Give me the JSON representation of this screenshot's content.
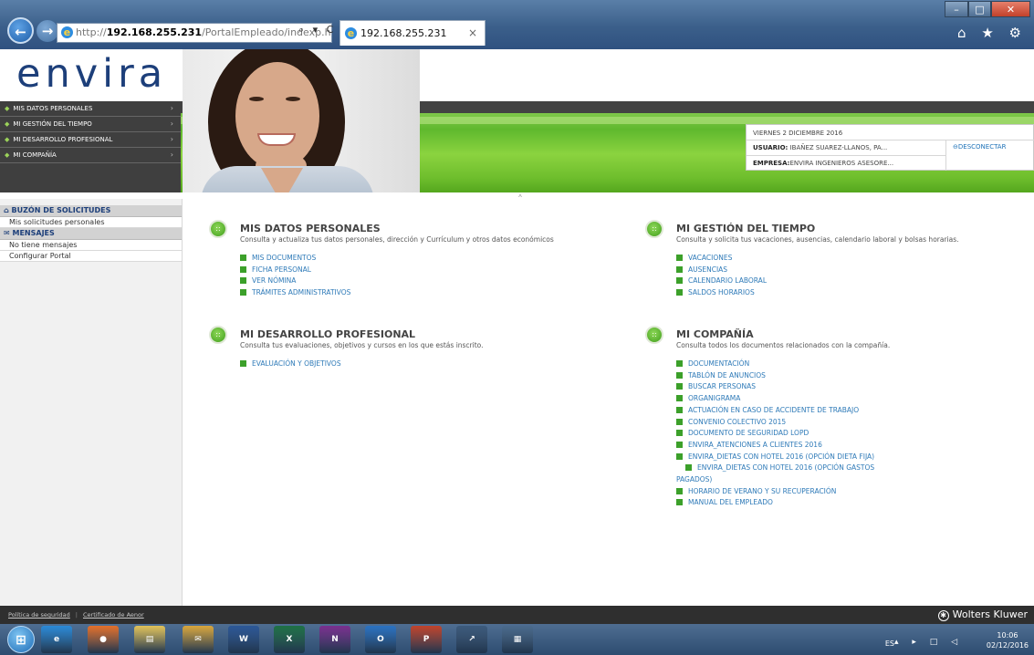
{
  "browser": {
    "url_prefix": "http://",
    "url_host": "192.168.255.231",
    "url_path": "/PortalEmpleado/indexp.html",
    "tab_title": "192.168.255.231",
    "addr_tools": "⌕ ▾ C",
    "tab_close": "×",
    "back_glyph": "←",
    "forward_glyph": "→",
    "favorites_glyphs": "⌂ ★ ⚙",
    "min_glyph": "–",
    "max_glyph": "□",
    "close_glyph": "✕"
  },
  "header": {
    "logo": "envira",
    "menu": [
      {
        "label": "MIS DATOS PERSONALES"
      },
      {
        "label": "MI GESTIÓN DEL TIEMPO"
      },
      {
        "label": "MI DESARROLLO PROFESIONAL"
      },
      {
        "label": "MI COMPAÑÍA"
      }
    ],
    "date": "VIERNES 2 DICIEMBRE 2016",
    "user_key": "USUARIO:",
    "user_value": "IBAÑEZ SUAREZ-LLANOS, PA...",
    "company_key": "EMPRESA:",
    "company_value": "ENVIRA INGENIEROS ASESORE...",
    "logout": "DESCONECTAR",
    "collapse_glyph": "˄"
  },
  "left_panel": {
    "inbox_title": "BUZÓN DE SOLICITUDES",
    "inbox_item": "Mis solicitudes personales",
    "messages_title": "MENSAJES",
    "messages_item": "No tiene mensajes",
    "configure": "Configurar Portal"
  },
  "sections": {
    "personal": {
      "title": "MIS DATOS PERSONALES",
      "desc": "Consulta y actualiza tus datos personales, dirección y Currículum y otros datos económicos",
      "links": [
        "MIS DOCUMENTOS",
        "FICHA PERSONAL",
        "VER NÓMINA",
        "TRÁMITES ADMINISTRATIVOS"
      ]
    },
    "time": {
      "title": "MI GESTIÓN DEL TIEMPO",
      "desc": "Consulta y solicita tus vacaciones, ausencias, calendario laboral y bolsas horarias.",
      "links": [
        "VACACIONES",
        "AUSENCIAS",
        "CALENDARIO LABORAL",
        "SALDOS HORARIOS"
      ]
    },
    "development": {
      "title": "MI DESARROLLO PROFESIONAL",
      "desc": "Consulta tus evaluaciones, objetivos y cursos en los que estás inscrito.",
      "links": [
        "EVALUACIÓN Y OBJETIVOS"
      ]
    },
    "company": {
      "title": "MI COMPAÑÍA",
      "desc": "Consulta todos los documentos relacionados con la compañía.",
      "links": [
        "DOCUMENTACIÓN",
        "TABLÓN DE ANUNCIOS",
        "BUSCAR PERSONAS",
        "ORGANIGRAMA",
        "ACTUACIÓN EN CASO DE ACCIDENTE DE TRABAJO",
        "CONVENIO COLECTIVO 2015",
        "DOCUMENTO DE SEGURIDAD LOPD",
        "ENVIRA_ATENCIONES A CLIENTES 2016",
        "ENVIRA_DIETAS CON HOTEL 2016 (OPCIÓN DIETA FIJA)",
        "ENVIRA_DIETAS CON HOTEL 2016 (OPCIÓN GASTOS PAGADOS)",
        "HORARIO DE VERANO Y SU RECUPERACIÓN",
        "MANUAL DEL EMPLEADO"
      ]
    }
  },
  "footer": {
    "security_policy": "Política de seguridad",
    "separator": "|",
    "certificate": "Certificado de Aenor",
    "brand": "Wolters Kluwer"
  },
  "taskbar": {
    "apps": [
      {
        "name": "internet-explorer",
        "glyph": "e",
        "color": "#2a8ad8"
      },
      {
        "name": "firefox",
        "glyph": "●",
        "color": "#e4702a"
      },
      {
        "name": "file-explorer",
        "glyph": "▤",
        "color": "#e2c35a"
      },
      {
        "name": "outlook-express",
        "glyph": "✉",
        "color": "#d9a63c"
      },
      {
        "name": "word",
        "glyph": "W",
        "color": "#2b5797"
      },
      {
        "name": "excel",
        "glyph": "X",
        "color": "#1e7145"
      },
      {
        "name": "onenote",
        "glyph": "N",
        "color": "#7a2f8f"
      },
      {
        "name": "outlook",
        "glyph": "O",
        "color": "#2a72c2"
      },
      {
        "name": "powerpoint",
        "glyph": "P",
        "color": "#c1432b"
      },
      {
        "name": "chart-app",
        "glyph": "↗",
        "color": "#3c5a7c"
      },
      {
        "name": "presentation-app",
        "glyph": "▦",
        "color": "#4a6a8c"
      }
    ],
    "language": "ES",
    "tray_icons": "▴ ▸ □ ◁",
    "time": "10:06",
    "date": "02/12/2016"
  }
}
